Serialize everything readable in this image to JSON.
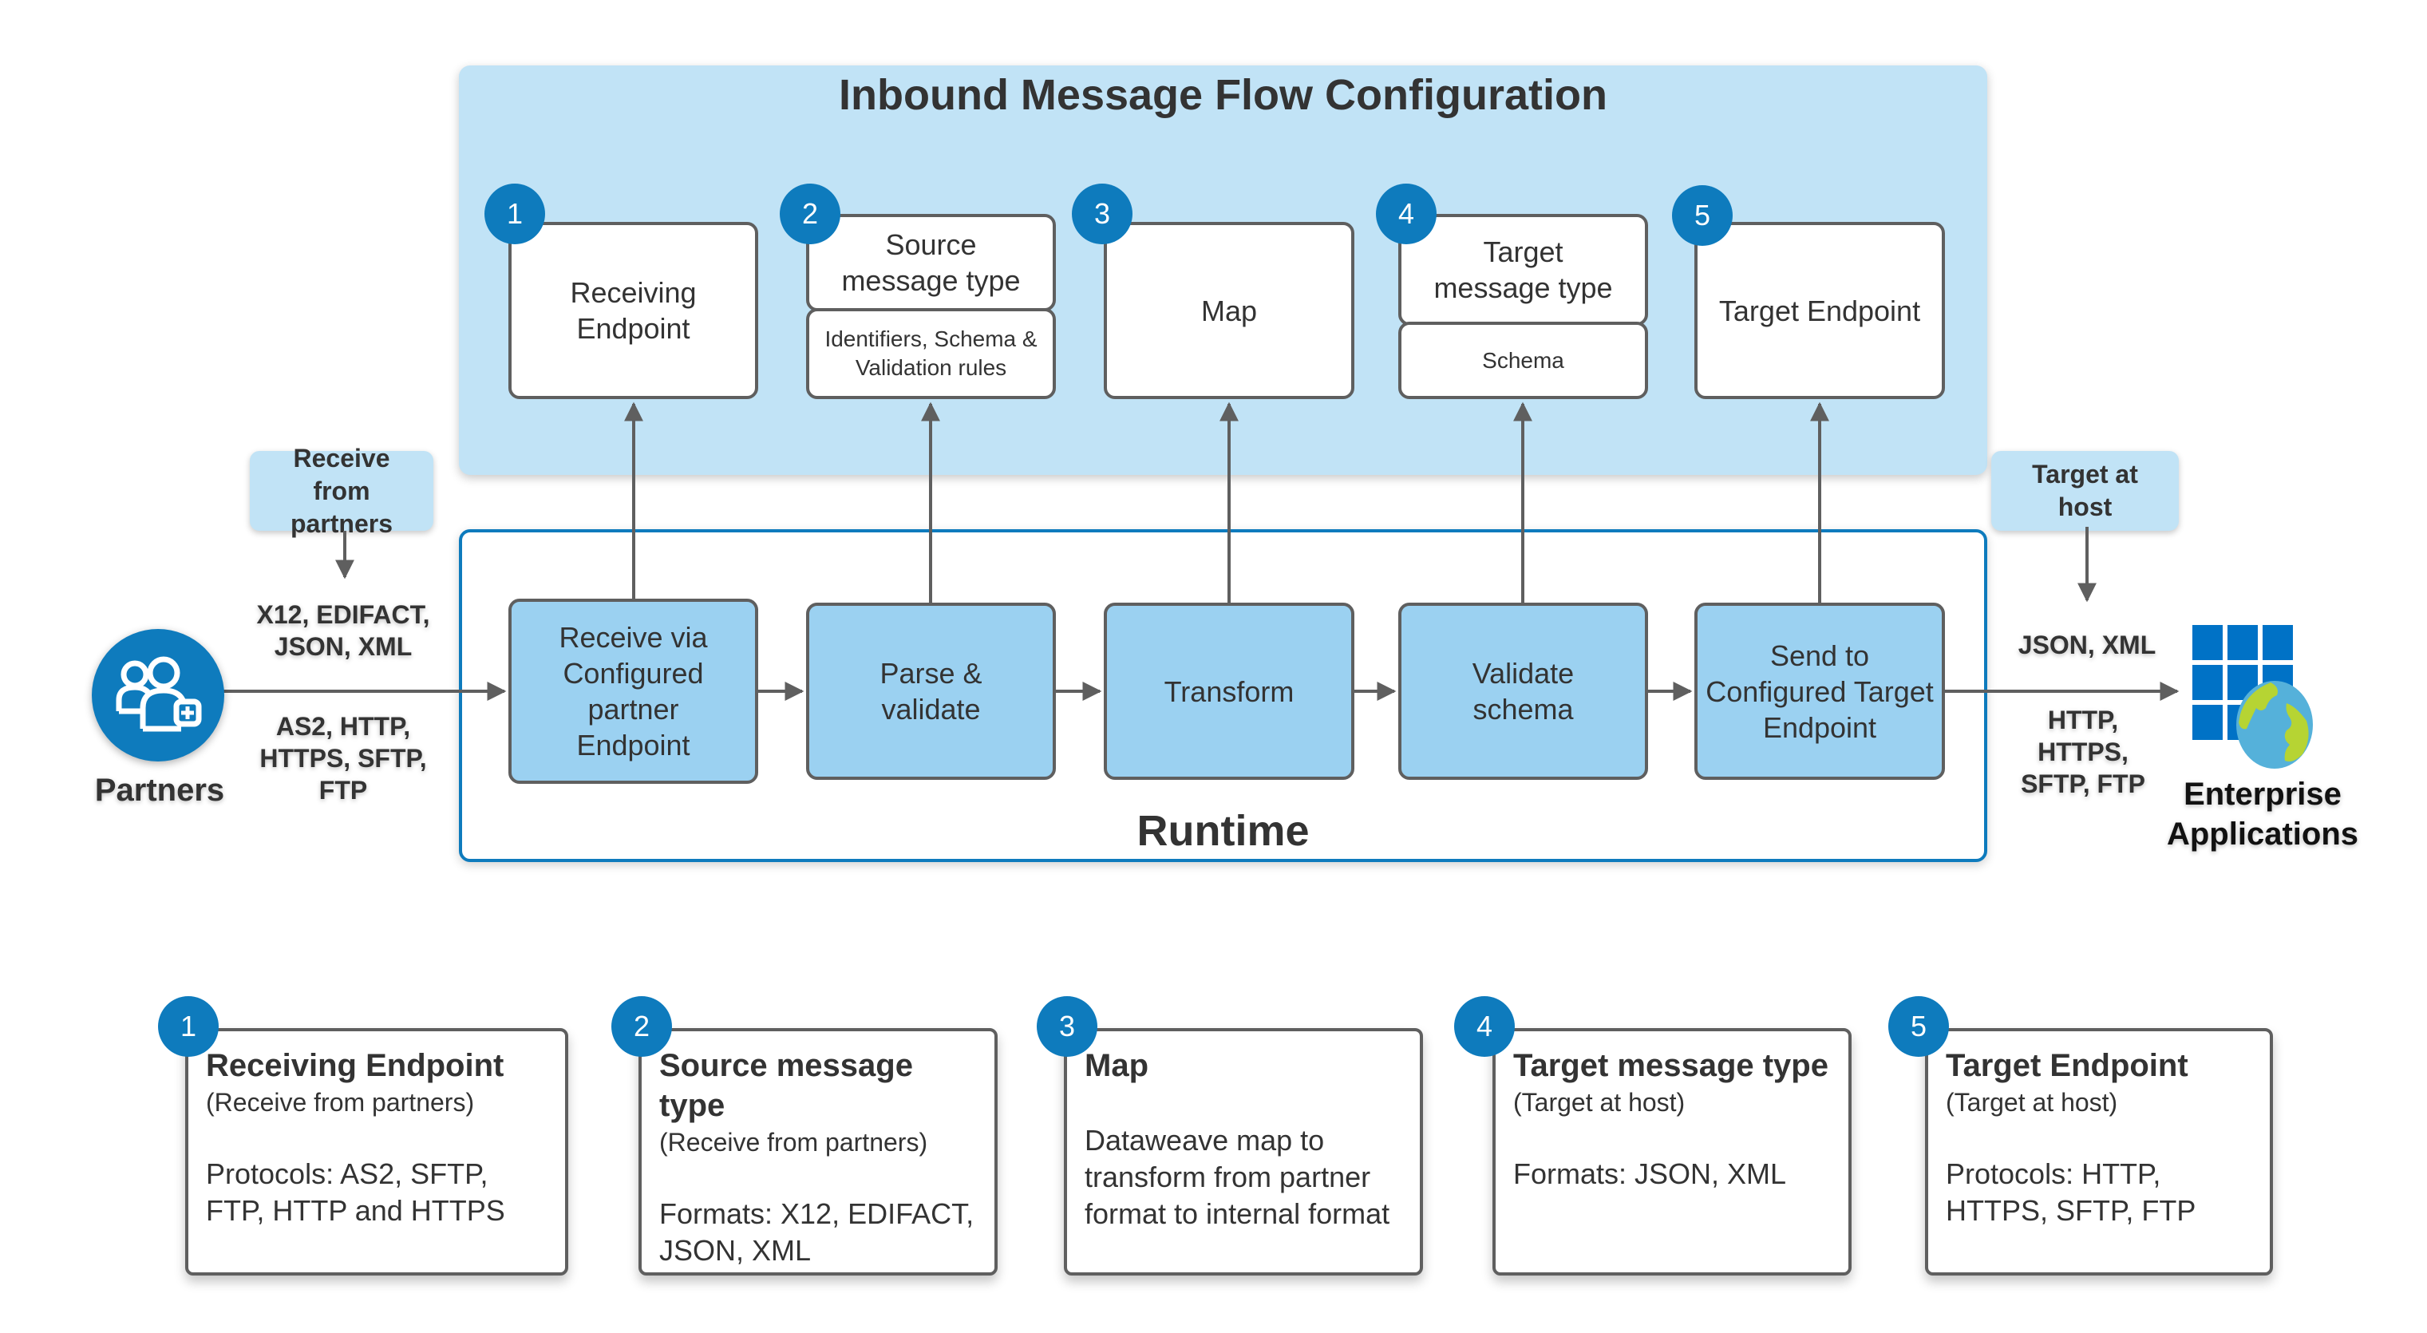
{
  "config_panel": {
    "title": "Inbound Message Flow Configuration",
    "steps": [
      {
        "number": "1",
        "title": "Receiving Endpoint",
        "subtitle": ""
      },
      {
        "number": "2",
        "title": "Source message type",
        "subtitle": "Identifiers, Schema & Validation rules"
      },
      {
        "number": "3",
        "title": "Map",
        "subtitle": ""
      },
      {
        "number": "4",
        "title": "Target message type",
        "subtitle": "Schema"
      },
      {
        "number": "5",
        "title": "Target Endpoint",
        "subtitle": ""
      }
    ]
  },
  "runtime_panel": {
    "title": "Runtime",
    "steps": [
      "Receive via Configured partner Endpoint",
      "Parse & validate",
      "Transform",
      "Validate schema",
      "Send to Configured Target Endpoint"
    ]
  },
  "partners": {
    "label": "Partners",
    "icon": "users-add-icon",
    "callout": "Receive from partners",
    "formats": "X12, EDIFACT, JSON, XML",
    "protocols": "AS2, HTTP, HTTPS, SFTP, FTP"
  },
  "enterprise": {
    "label": "Enterprise Applications",
    "icon": "enterprise-globe-icon",
    "callout": "Target at host",
    "formats": "JSON, XML",
    "protocols": "HTTP, HTTPS, SFTP, FTP"
  },
  "cards": [
    {
      "number": "1",
      "title": "Receiving Endpoint",
      "subtitle": "(Receive from partners)",
      "body": "Protocols: AS2, SFTP, FTP, HTTP and HTTPS"
    },
    {
      "number": "2",
      "title": "Source message type",
      "subtitle": "(Receive from partners)",
      "body": "Formats: X12, EDIFACT, JSON, XML"
    },
    {
      "number": "3",
      "title": "Map",
      "subtitle": "",
      "body": "Dataweave map to transform from partner format to internal format"
    },
    {
      "number": "4",
      "title": "Target message type",
      "subtitle": "(Target at host)",
      "body": "Formats:  JSON, XML"
    },
    {
      "number": "5",
      "title": "Target Endpoint",
      "subtitle": "(Target at host)",
      "body": "Protocols:  HTTP, HTTPS, SFTP, FTP"
    }
  ],
  "colors": {
    "config_bg": "#c1e3f6",
    "runtime_border": "#0e7bbd",
    "runtime_box": "#9bd1f1",
    "badge": "#0e7bbd",
    "connector": "#5f5f5f"
  }
}
